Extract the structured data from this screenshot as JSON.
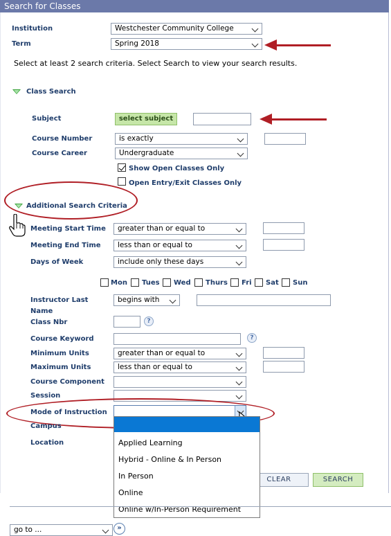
{
  "window": {
    "title": "Search for Classes"
  },
  "institution": {
    "label": "Institution",
    "value": "Westchester Community College"
  },
  "term": {
    "label": "Term",
    "value": "Spring 2018"
  },
  "instructions": "Select at least 2 search criteria. Select Search to view your search results.",
  "class_search": {
    "header": "Class Search",
    "subject": {
      "label": "Subject",
      "button": "select subject",
      "value": ""
    },
    "course_number": {
      "label": "Course Number",
      "operator": "is exactly",
      "value": ""
    },
    "course_career": {
      "label": "Course Career",
      "value": "Undergraduate"
    },
    "open_only": {
      "label": "Show Open Classes Only",
      "checked": true
    },
    "open_entry": {
      "label": "Open Entry/Exit Classes Only",
      "checked": false
    }
  },
  "additional": {
    "header": "Additional Search Criteria",
    "meeting_start": {
      "label": "Meeting Start Time",
      "operator": "greater than or equal to"
    },
    "meeting_end": {
      "label": "Meeting End Time",
      "operator": "less than or equal to"
    },
    "days_of_week": {
      "label": "Days of Week",
      "operator": "include only these days"
    },
    "days": [
      "Mon",
      "Tues",
      "Wed",
      "Thurs",
      "Fri",
      "Sat",
      "Sun"
    ],
    "instructor_last_name": {
      "label_line1": "Instructor Last",
      "label_line2": "Name",
      "operator": "begins with"
    },
    "class_nbr": {
      "label": "Class Nbr"
    },
    "course_keyword": {
      "label": "Course Keyword"
    },
    "minimum_units": {
      "label": "Minimum Units",
      "operator": "greater than or equal to"
    },
    "maximum_units": {
      "label": "Maximum Units",
      "operator": "less than or equal to"
    },
    "course_component": {
      "label": "Course Component"
    },
    "session": {
      "label": "Session"
    },
    "mode_of_instruction": {
      "label": "Mode of Instruction",
      "options": [
        "Applied Learning",
        "Hybrid - Online & In Person",
        "In Person",
        "Online",
        "Online w/In-Person Requirement"
      ]
    },
    "campus": {
      "label": "Campus"
    },
    "location": {
      "label": "Location"
    }
  },
  "buttons": {
    "clear": "Clear",
    "search": "Search",
    "help": "?"
  },
  "footer": {
    "goto": "go to ..."
  },
  "colors": {
    "title_bar": "#6b79a9",
    "label_text": "#1f3d6b",
    "annotation_red": "#b01e25",
    "dropdown_highlight": "#0a78d4"
  }
}
